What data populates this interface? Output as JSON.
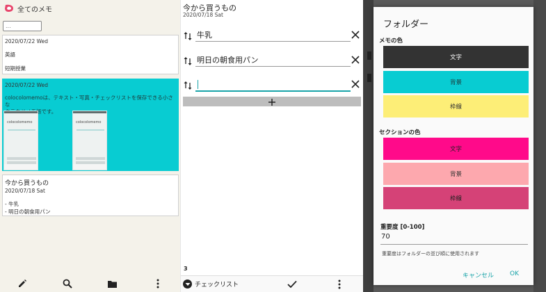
{
  "list_panel": {
    "title": "全てのメモ",
    "search_placeholder": "...",
    "cards": [
      {
        "date": "2020/07/22 Wed",
        "lines": [
          "英語",
          "短期授業"
        ]
      },
      {
        "date": "2020/07/22 Wed",
        "body_line1": "colocolomemoは、テキスト・写真・チェックリストを保存できる小さな",
        "body_line2": "クラウドメモ帳です。",
        "thumb_text": "colocolomemo"
      },
      {
        "title": "今から買うもの",
        "date": "2020/07/18 Sat",
        "lines": [
          "- 牛乳",
          "- 明日の朝食用パン"
        ]
      }
    ],
    "toolbar": [
      "pencil-icon",
      "search-icon",
      "folder-icon",
      "more-vert-icon"
    ]
  },
  "editor": {
    "title": "今から買うもの",
    "date": "2020/07/18 Sat",
    "items": [
      "牛乳",
      "明日の朝食用パン",
      ""
    ],
    "add_label": "+",
    "count": "3",
    "mode_label": "チェックリスト"
  },
  "dialog": {
    "title": "フォルダー",
    "memo_color_label": "メモの色",
    "memo_buttons": [
      {
        "label": "文字",
        "bg": "#333333",
        "fg": "#ffffff"
      },
      {
        "label": "背景",
        "bg": "#08ccd2",
        "fg": "#1d3b3c"
      },
      {
        "label": "枠線",
        "bg": "#fdee77",
        "fg": "#333333"
      }
    ],
    "section_color_label": "セクションの色",
    "section_buttons": [
      {
        "label": "文字",
        "bg": "#ff0a8a",
        "fg": "#222222"
      },
      {
        "label": "背景",
        "bg": "#fda8ae",
        "fg": "#333333"
      },
      {
        "label": "枠線",
        "bg": "#d54277",
        "fg": "#222222"
      }
    ],
    "importance_label": "重要度 [0-100]",
    "importance_value": "70",
    "hint": "重要度はフォルダーの並び順に使用されます",
    "cancel": "キャンセル",
    "ok": "OK"
  },
  "colors": {
    "accent": "#17a3a8",
    "logo": "#e8466c"
  }
}
